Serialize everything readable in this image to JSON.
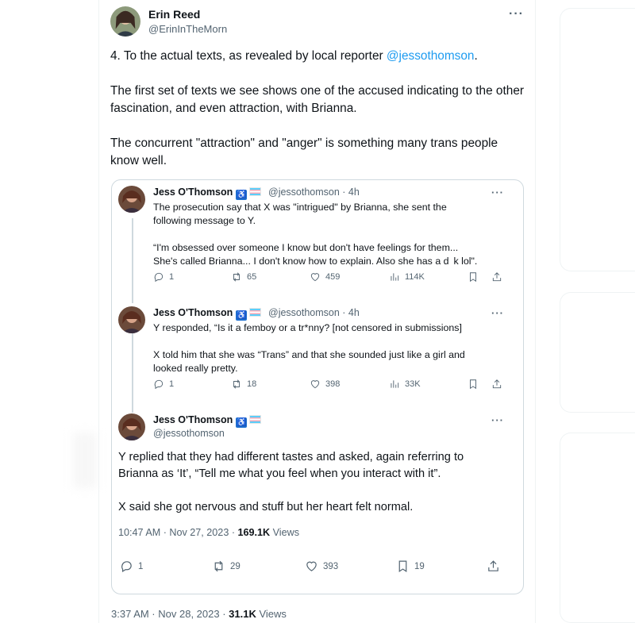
{
  "author": {
    "name": "Erin Reed",
    "handle": "@ErinInTheMorn"
  },
  "tweet": {
    "paragraph_1_prefix": "4. To the actual texts, as revealed by local reporter ",
    "paragraph_1_mention": "@jessothomson",
    "paragraph_1_suffix": ".",
    "paragraph_2": "The first set of texts we see shows one of the accused indicating to the other fascination, and even attraction, with Brianna.",
    "paragraph_3": "The concurrent \"attraction\" and \"anger\" is something many trans people know well.",
    "timestamp": "3:37 AM · Nov 28, 2023 · ",
    "views_count": "31.1K",
    "views_label": " Views"
  },
  "quoted_thread": {
    "author_name": "Jess O'Thomson",
    "handle_time": "@jessothomson · 4h",
    "handle": "@jessothomson",
    "post_1": {
      "lines": [
        "The prosecution say that X was \"intrigued\" by Brianna, she sent the",
        "following message to Y.",
        "",
        "“I'm obsessed over someone I know but don't have feelings for them...",
        "She's called Brianna... I don't know how to explain. Also she has a d  k lol\"."
      ],
      "replies": "1",
      "reposts": "65",
      "likes": "459",
      "views": "114K"
    },
    "post_2": {
      "lines": [
        "Y responded, “Is it a femboy or a tr*nny? [not censored in submissions]",
        "",
        "X told him that she was “Trans” and that she sounded just like a girl and",
        "looked really pretty."
      ],
      "replies": "1",
      "reposts": "18",
      "likes": "398",
      "views": "33K"
    },
    "post_3": {
      "line_1": "Y replied that they had different tastes and asked, again referring to",
      "line_2": "Brianna as ‘It’, “Tell me what you feel when you interact with it”.",
      "line_3": "X said she got nervous and stuff but her heart felt normal.",
      "timestamp": "10:47 AM · Nov 27, 2023 · ",
      "views_count": "169.1K",
      "views_label": " Views",
      "replies": "1",
      "reposts": "29",
      "likes": "393",
      "bookmarks": "19"
    }
  },
  "icons": {
    "more": "more-icon",
    "reply": "reply-icon",
    "repost": "repost-icon",
    "like": "heart-icon",
    "views": "views-icon",
    "bookmark": "bookmark-icon",
    "share": "share-icon",
    "wheelchair_emoji": "wheelchair-emoji-icon",
    "trans_flag_emoji": "trans-flag-emoji-icon"
  },
  "colors": {
    "link": "#1d9bf0",
    "secondary_text": "#536471",
    "border": "#cfd9de"
  }
}
